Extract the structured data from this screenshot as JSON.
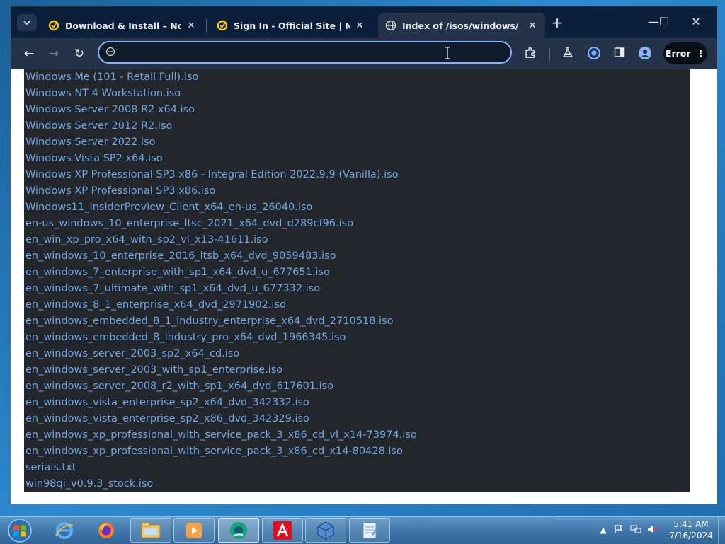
{
  "tabs": [
    {
      "title": "Download & Install – Norton™",
      "close": "✕",
      "icon": "norton-icon"
    },
    {
      "title": "Sign In - Official Site | Norton",
      "close": "✕",
      "icon": "norton-icon"
    },
    {
      "title": "Index of /isos/windows/",
      "close": "✕",
      "icon": "globe-icon",
      "active": true
    }
  ],
  "new_tab": "+",
  "window_controls": {
    "minimize": "—",
    "maximize": "☐",
    "close": "✕"
  },
  "toolbar": {
    "back": "←",
    "forward": "→",
    "reload": "↻",
    "omnibox_value": "",
    "error_label": "Error",
    "menu_glyph": "⋮"
  },
  "files": [
    {
      "name": "Windows Me (101 - Retail Full).iso"
    },
    {
      "name": "Windows NT 4 Workstation.iso"
    },
    {
      "name": "Windows Server 2008 R2 x64.iso"
    },
    {
      "name": "Windows Server 2012 R2.iso"
    },
    {
      "name": "Windows Server 2022.iso"
    },
    {
      "name": "Windows Vista SP2 x64.iso"
    },
    {
      "name": "Windows XP Professional SP3 x86 - Integral Edition 2022.9.9 (Vanilla).iso"
    },
    {
      "name": "Windows XP Professional SP3 x86.iso"
    },
    {
      "name": "Windows11_InsiderPreview_Client_x64_en-us_26040.iso"
    },
    {
      "name": "en-us_windows_10_enterprise_ltsc_2021_x64_dvd_d289cf96.iso"
    },
    {
      "name": "en_win_xp_pro_x64_with_sp2_vl_x13-41611.iso"
    },
    {
      "name": "en_windows_10_enterprise_2016_ltsb_x64_dvd_9059483.iso"
    },
    {
      "name": "en_windows_7_enterprise_with_sp1_x64_dvd_u_677651.iso"
    },
    {
      "name": "en_windows_7_ultimate_with_sp1_x64_dvd_u_677332.iso"
    },
    {
      "name": "en_windows_8_1_enterprise_x64_dvd_2971902.iso"
    },
    {
      "name": "en_windows_embedded_8_1_industry_enterprise_x64_dvd_2710518.iso"
    },
    {
      "name": "en_windows_embedded_8_industry_pro_x64_dvd_1966345.iso"
    },
    {
      "name": "en_windows_server_2003_sp2_x64_cd.iso"
    },
    {
      "name": "en_windows_server_2003_with_sp1_enterprise.iso"
    },
    {
      "name": "en_windows_server_2008_r2_with_sp1_x64_dvd_617601.iso"
    },
    {
      "name": "en_windows_vista_enterprise_sp2_x64_dvd_342332.iso"
    },
    {
      "name": "en_windows_vista_enterprise_sp2_x86_dvd_342329.iso"
    },
    {
      "name": "en_windows_xp_professional_with_service_pack_3_x86_cd_vl_x14-73974.iso"
    },
    {
      "name": "en_windows_xp_professional_with_service_pack_3_x86_cd_x14-80428.iso"
    },
    {
      "name": "serials.txt"
    },
    {
      "name": "win98qi_v0.9.3_stock.iso"
    }
  ],
  "taskbar_apps": [
    {
      "icon": "internet-explorer-icon"
    },
    {
      "icon": "firefox-icon"
    },
    {
      "icon": "file-explorer-icon"
    },
    {
      "icon": "media-player-icon"
    },
    {
      "icon": "browser-icon"
    },
    {
      "icon": "avira-icon"
    },
    {
      "icon": "virtualbox-icon"
    },
    {
      "icon": "notepad-icon"
    }
  ],
  "tray": {
    "show_hidden": "▲",
    "time": "5:41 AM",
    "date": "7/16/2024"
  },
  "colors": {
    "tab_strip": "#0b1f3a",
    "toolbar": "#24324a",
    "listing_bg": "#23262a",
    "link": "#6ea6e6",
    "omnibox_focus": "#8ab4f8"
  }
}
